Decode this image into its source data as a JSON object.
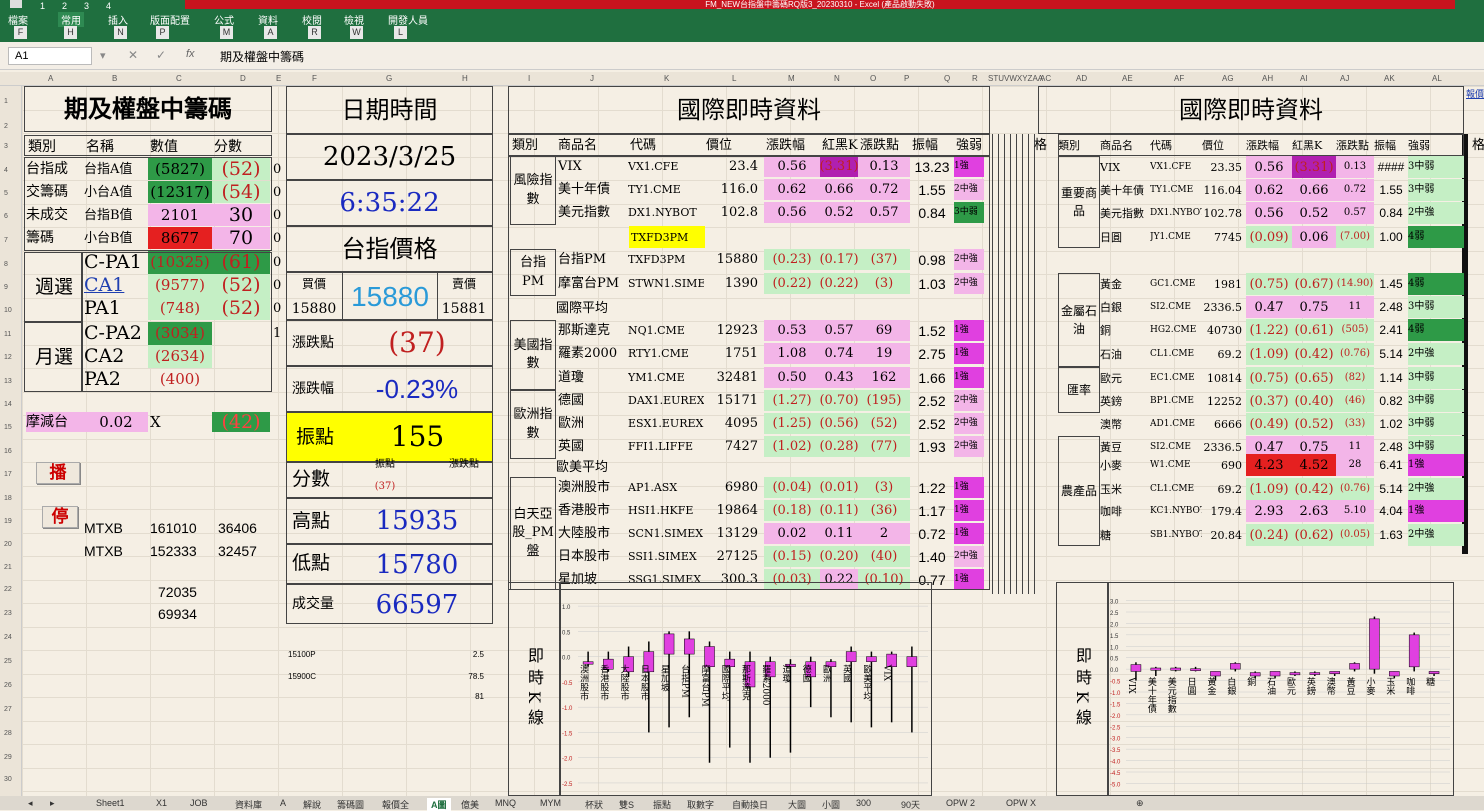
{
  "app": {
    "title": "FM_NEW台指盤中籌碼RQ版3_20230310 - Excel (產品啟動失敗)",
    "tabs": [
      "檔案",
      "常用",
      "插入",
      "版面配置",
      "公式",
      "資料",
      "校閱",
      "檢視",
      "開發人員"
    ],
    "keytips": [
      "F",
      "H",
      "N",
      "P",
      "M",
      "A",
      "R",
      "W",
      "L"
    ],
    "qat": [
      "1",
      "2",
      "3",
      "4"
    ]
  },
  "formula": {
    "cell": "A1",
    "value": "期及權盤中籌碼",
    "fx": "fx"
  },
  "columns": [
    "A",
    "B",
    "C",
    "D",
    "E",
    "F",
    "G",
    "H",
    "I",
    "J",
    "K",
    "L",
    "M",
    "N",
    "O",
    "P",
    "Q",
    "R",
    "STUVWXYZAA",
    "AC",
    "AD",
    "AE",
    "AF",
    "AG",
    "AH",
    "AI",
    "AJ",
    "AK",
    "AL"
  ],
  "rows": [
    "1",
    "2",
    "3",
    "4",
    "5",
    "6",
    "7",
    "8",
    "9",
    "10",
    "11",
    "12",
    "13",
    "14",
    "15",
    "16",
    "17",
    "18",
    "19",
    "20",
    "21",
    "22",
    "23",
    "24",
    "25",
    "26",
    "27",
    "28",
    "29",
    "30",
    "31",
    "32"
  ],
  "left": {
    "title": "期及權盤中籌碼",
    "headers": [
      "類別",
      "名稱",
      "數值",
      "分數"
    ],
    "r1": [
      "台指成",
      "台指A值",
      "(5827)",
      "(52)",
      "0"
    ],
    "r2": [
      "交籌碼",
      "小台A值",
      "(12317)",
      "(54)",
      "0"
    ],
    "r3": [
      "未成交",
      "台指B值",
      "2101",
      "30",
      "0"
    ],
    "r4": [
      "籌碼",
      "小台B值",
      "8677",
      "70",
      "0"
    ],
    "weekly": "週選",
    "monthly": "月選",
    "w1": [
      "C-PA1",
      "(10325)",
      "(61)",
      "0"
    ],
    "w2": [
      "CA1",
      "(9577)",
      "(52)",
      "0"
    ],
    "w3": [
      "PA1",
      "(748)",
      "(52)",
      "0"
    ],
    "m1": [
      "C-PA2",
      "(3034)",
      "1"
    ],
    "m2": [
      "CA2",
      "(2634)"
    ],
    "m3": [
      "PA2",
      "(400)"
    ],
    "decay": [
      "摩減台",
      "0.02",
      "X",
      "(42)"
    ],
    "play": "播",
    "stop": "停",
    "mtx1": [
      "MTXB",
      "161010",
      "36406"
    ],
    "mtx2": [
      "MTXB",
      "152333",
      "32457"
    ],
    "n1": "72035",
    "n2": "69934"
  },
  "mid": {
    "dt_title": "日期時間",
    "date": "2023/3/25",
    "time": "6:35:22",
    "px_title": "台指價格",
    "bid_l": "買價",
    "ask_l": "賣價",
    "bid": "15880",
    "price": "15880",
    "ask": "15881",
    "chg_l": "漲跌點",
    "chg": "(37)",
    "pct_l": "漲跌幅",
    "pct": "-0.23%",
    "amp_l": "振點",
    "amp": "155",
    "score_l": "分數",
    "sc_h1": "振點",
    "sc_h2": "漲跌點",
    "sc_v": "(37)",
    "high_l": "高點",
    "high": "15935",
    "low_l": "低點",
    "low": "15780",
    "vol_l": "成交量",
    "vol": "66597",
    "o1": [
      "15100P",
      "2.5"
    ],
    "o2": [
      "15900C",
      "78.5"
    ],
    "o3": "81"
  },
  "intl": {
    "title": "國際即時資料",
    "headers": [
      "類別",
      "商品名",
      "代碼",
      "價位",
      "漲跌幅",
      "紅黑K",
      "漲跌點",
      "振幅",
      "強弱"
    ],
    "g1": "風險指數",
    "r1": [
      "VIX",
      "VX1.CFE",
      "23.4",
      "0.56",
      "(3.31)",
      "0.13",
      "13.23",
      "1強"
    ],
    "r2": [
      "美十年債",
      "TY1.CME",
      "116.0",
      "0.62",
      "0.66",
      "0.72",
      "1.55",
      "2中強"
    ],
    "r3": [
      "美元指數",
      "DX1.NYBOT",
      "102.8",
      "0.56",
      "0.52",
      "0.57",
      "0.84",
      "3中弱"
    ],
    "tx": "TXFD3PM",
    "g2": "台指PM",
    "r4": [
      "台指PM",
      "TXFD3PM",
      "15880",
      "(0.23)",
      "(0.17)",
      "(37)",
      "0.98",
      "2中強"
    ],
    "r5": [
      "摩富台PM",
      "STWN1.SIMEX",
      "1390",
      "(0.22)",
      "(0.22)",
      "(3)",
      "1.03",
      "2中強"
    ],
    "avg1": "國際平均",
    "g3": "美國指數",
    "r6": [
      "那斯達克",
      "NQ1.CME",
      "12923",
      "0.53",
      "0.57",
      "69",
      "1.52",
      "1強"
    ],
    "r7": [
      "羅素2000",
      "RTY1.CME",
      "1751",
      "1.08",
      "0.74",
      "19",
      "2.75",
      "1強"
    ],
    "r8": [
      "道瓊",
      "YM1.CME",
      "32481",
      "0.50",
      "0.43",
      "162",
      "1.66",
      "1強"
    ],
    "g4": "歐洲指數",
    "r9": [
      "德國",
      "DAX1.EUREX",
      "15171",
      "(1.27)",
      "(0.70)",
      "(195)",
      "2.52",
      "2中強"
    ],
    "r10": [
      "歐洲",
      "ESX1.EUREX",
      "4095",
      "(1.25)",
      "(0.56)",
      "(52)",
      "2.52",
      "2中強"
    ],
    "r11": [
      "英國",
      "FFI1.LIFFE",
      "7427",
      "(1.02)",
      "(0.28)",
      "(77)",
      "1.93",
      "2中強"
    ],
    "avg2": "歐美平均",
    "g5": "白天亞股_PM盤",
    "r12": [
      "澳洲股市",
      "AP1.ASX",
      "6980",
      "(0.04)",
      "(0.01)",
      "(3)",
      "1.22",
      "1強"
    ],
    "r13": [
      "香港股市",
      "HSI1.HKFE",
      "19864",
      "(0.18)",
      "(0.11)",
      "(36)",
      "1.17",
      "1強"
    ],
    "r14": [
      "大陸股市",
      "SCN1.SIMEX",
      "13129",
      "0.02",
      "0.11",
      "2",
      "0.72",
      "1強"
    ],
    "r15": [
      "日本股市",
      "SSI1.SIMEX",
      "27125",
      "(0.15)",
      "(0.20)",
      "(40)",
      "1.40",
      "2中強"
    ],
    "r16": [
      "星加坡",
      "SSG1.SIMEX",
      "300.3",
      "(0.03)",
      "0.22",
      "(0.10)",
      "0.77",
      "1強"
    ],
    "kline": "即時K線"
  },
  "right": {
    "title": "國際即時資料",
    "hdr_extra": "格",
    "headers": [
      "類別",
      "商品名",
      "代碼",
      "價位",
      "漲跌幅",
      "紅黑K",
      "漲跌點",
      "振幅",
      "強弱"
    ],
    "g1": "重要商品",
    "g2": "金屬石油",
    "g3": "匯率",
    "g4": "農產品",
    "r1": [
      "VIX",
      "VX1.CFE",
      "23.35",
      "0.56",
      "(3.31)",
      "0.13",
      "####",
      "3中弱"
    ],
    "r2": [
      "美十年債",
      "TY1.CME",
      "116.04",
      "0.62",
      "0.66",
      "0.72",
      "1.55",
      "3中弱"
    ],
    "r3": [
      "美元指數",
      "DX1.NYBOT",
      "102.78",
      "0.56",
      "0.52",
      "0.57",
      "0.84",
      "2中強"
    ],
    "r4": [
      "日圓",
      "JY1.CME",
      "7745",
      "(0.09)",
      "0.06",
      "(7.00)",
      "1.00",
      "4弱"
    ],
    "r5": [
      "黃金",
      "GC1.CME",
      "1981",
      "(0.75)",
      "(0.67)",
      "(14.90)",
      "1.45",
      "4弱"
    ],
    "r6": [
      "白銀",
      "SI2.CME",
      "2336.5",
      "0.47",
      "0.75",
      "11",
      "2.48",
      "3中弱"
    ],
    "r7": [
      "銅",
      "HG2.CME",
      "40730",
      "(1.22)",
      "(0.61)",
      "(505)",
      "2.41",
      "4弱"
    ],
    "r8": [
      "石油",
      "CL1.CME",
      "69.2",
      "(1.09)",
      "(0.42)",
      "(0.76)",
      "5.14",
      "2中強"
    ],
    "r9": [
      "歐元",
      "EC1.CME",
      "10814",
      "(0.75)",
      "(0.65)",
      "(82)",
      "1.14",
      "3中弱"
    ],
    "r10": [
      "英鎊",
      "BP1.CME",
      "12252",
      "(0.37)",
      "(0.40)",
      "(46)",
      "0.82",
      "3中弱"
    ],
    "r11": [
      "澳幣",
      "AD1.CME",
      "6666",
      "(0.49)",
      "(0.52)",
      "(33)",
      "1.02",
      "3中弱"
    ],
    "r12": [
      "黃豆",
      "SI2.CME",
      "2336.5",
      "0.47",
      "0.75",
      "11",
      "2.48",
      "3中弱"
    ],
    "r13": [
      "小麥",
      "W1.CME",
      "690",
      "4.23",
      "4.52",
      "28",
      "6.41",
      "1強"
    ],
    "r14": [
      "玉米",
      "CL1.CME",
      "69.2",
      "(1.09)",
      "(0.42)",
      "(0.76)",
      "5.14",
      "2中強"
    ],
    "r15": [
      "咖啡",
      "KC1.NYBOT",
      "179.4",
      "2.93",
      "2.63",
      "5.10",
      "4.04",
      "1強"
    ],
    "r16": [
      "糖",
      "SB1.NYBOT",
      "20.84",
      "(0.24)",
      "(0.62)",
      "(0.05)",
      "1.63",
      "2中強"
    ],
    "kline": "即時K線",
    "edge": "格",
    "link": "報價"
  },
  "sheets": [
    "Sheet1",
    "X1",
    "JOB",
    "資料庫",
    "A",
    "解說",
    "籌碼圖",
    "報價全",
    "A圖",
    "億美",
    "MNQ",
    "MYM",
    "杯狀",
    "雙S",
    "振點",
    "取數字",
    "自動換日",
    "大圖",
    "小圖",
    "300",
    "90天",
    "OPW 2",
    "OPW X"
  ],
  "chart1": {
    "yticks": [
      "1.0",
      "0.5",
      "0.0",
      "-0.5",
      "-1.0",
      "-1.5",
      "-2.0",
      "-2.5"
    ],
    "labels": [
      "澳洲股市",
      "香港股市",
      "大陸股市",
      "日本股市",
      "星加坡",
      "台指PM",
      "摩富台PM",
      "國際平均",
      "那斯達克",
      "羅素2000",
      "道瓊",
      "德國",
      "歐洲",
      "英國",
      "歐美平均",
      "VIX"
    ],
    "candles": [
      [
        0.1,
        -0.2,
        -0.1,
        -0.15
      ],
      [
        0.1,
        -0.3,
        -0.05,
        -0.25
      ],
      [
        0.2,
        -0.4,
        0,
        -0.3
      ],
      [
        0.3,
        -1.5,
        0.1,
        -0.3
      ],
      [
        0.5,
        -1.4,
        0.45,
        0.05
      ],
      [
        0.5,
        -1.2,
        0.35,
        0.05
      ],
      [
        0.3,
        -2.1,
        0.2,
        -0.2
      ],
      [
        0.1,
        -1.8,
        -0.05,
        -0.2
      ],
      [
        0.1,
        -2.1,
        -0.1,
        -0.6
      ],
      [
        0.0,
        -2.0,
        -0.1,
        -0.4
      ],
      [
        -0.05,
        -1.9,
        -0.15,
        -0.2
      ],
      [
        0.0,
        -1.0,
        -0.1,
        -0.4
      ],
      [
        -0.05,
        -1.2,
        -0.1,
        -0.2
      ],
      [
        0.2,
        -1.3,
        0.1,
        -0.1
      ],
      [
        0.1,
        -1.4,
        0.0,
        -0.1
      ],
      [
        0.1,
        -1.3,
        0.05,
        -0.2
      ],
      [
        0.2,
        -1.5,
        0.0,
        -0.2
      ]
    ]
  },
  "chart2": {
    "yticks": [
      "3.0",
      "2.5",
      "2.0",
      "1.5",
      "1.0",
      "0.5",
      "0.0",
      "-0.5",
      "-1.0",
      "-1.5",
      "-2.0",
      "-2.5",
      "-3.0",
      "-3.5",
      "-4.0",
      "-4.5",
      "-5.0"
    ],
    "labels": [
      "VIX",
      "美十年債",
      "美元指數",
      "日圓",
      "黃金",
      "白銀",
      "銅",
      "石油",
      "歐元",
      "英鎊",
      "澳幣",
      "黃豆",
      "小麥",
      "玉米",
      "咖啡",
      "糖"
    ],
    "candles": [
      [
        0.3,
        -0.5,
        0.2,
        -0.1
      ],
      [
        0.1,
        -0.3,
        0.05,
        -0.05
      ],
      [
        0.1,
        -0.1,
        0.05,
        -0.05
      ],
      [
        0.1,
        -0.1,
        0.02,
        -0.02
      ],
      [
        -0.1,
        -0.5,
        -0.1,
        -0.3
      ],
      [
        0.3,
        -0.1,
        0.25,
        0.0
      ],
      [
        -0.1,
        -0.4,
        -0.15,
        -0.3
      ],
      [
        -0.1,
        -0.4,
        -0.1,
        -0.3
      ],
      [
        -0.1,
        -0.3,
        -0.15,
        -0.25
      ],
      [
        -0.1,
        -0.3,
        -0.15,
        -0.2
      ],
      [
        -0.1,
        -0.3,
        -0.1,
        -0.2
      ],
      [
        0.3,
        -0.1,
        0.25,
        0.0
      ],
      [
        2.3,
        -0.2,
        2.2,
        0.0
      ],
      [
        -0.1,
        -0.4,
        -0.1,
        -0.3
      ],
      [
        1.6,
        -0.1,
        1.5,
        0.1
      ],
      [
        -0.1,
        -0.3,
        -0.1,
        -0.2
      ]
    ]
  }
}
